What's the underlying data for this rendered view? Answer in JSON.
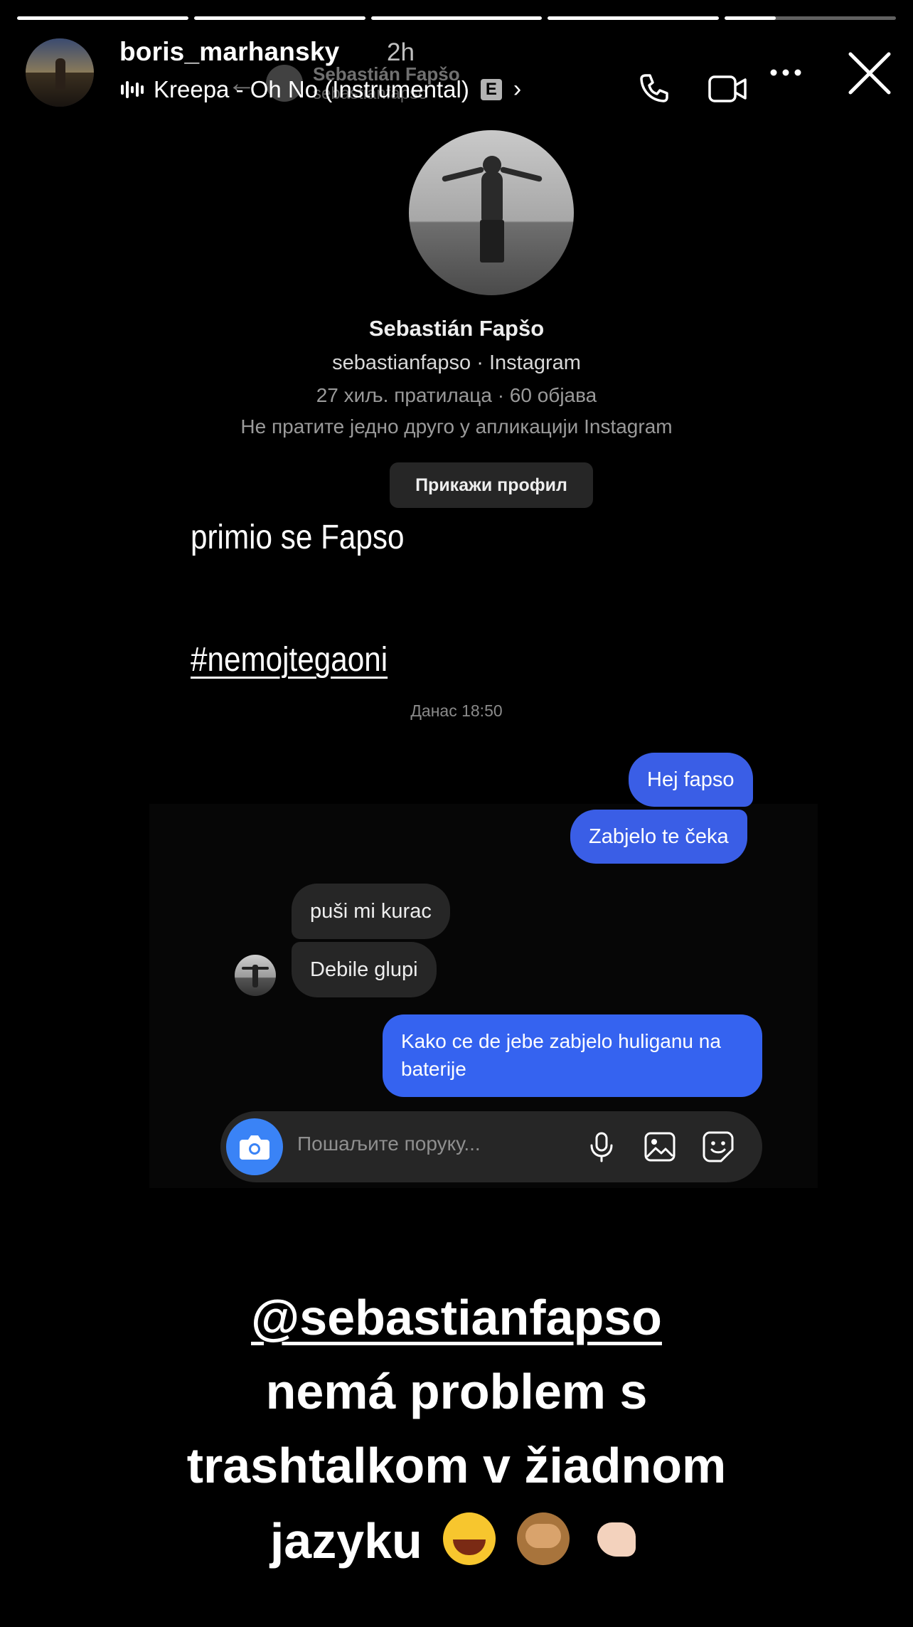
{
  "story": {
    "segments": [
      {
        "progress": 1.0
      },
      {
        "progress": 1.0
      },
      {
        "progress": 1.0
      },
      {
        "progress": 1.0
      },
      {
        "progress": 0.3
      }
    ],
    "username": "boris_marhansky",
    "time_ago": "2h",
    "music": {
      "track": "Kreepa - Oh No (Instrumental)",
      "explicit_badge": "E",
      "chevron": "›"
    },
    "icons": {
      "call": "phone-icon",
      "video": "video-icon",
      "more": "more-icon",
      "close": "close-icon"
    }
  },
  "screenshot": {
    "ghost_header": {
      "name": "Sebastián Fapšo",
      "username": "sebastianfapso"
    },
    "profile": {
      "name": "Sebastián Fapšo",
      "subtitle": "sebastianfapso · Instagram",
      "stats": "27 хиљ. пратилаца · 60 објава",
      "mutual_note": "Не пратите једно друго у апликацији Instagram",
      "view_profile_label": "Прикажи профил"
    },
    "date_label": "Данас 18:50",
    "messages": [
      {
        "from": "me",
        "text": "Hej fapso"
      },
      {
        "from": "me",
        "text": "Zabjelo te čeka"
      },
      {
        "from": "them",
        "text": "puši mi kurac"
      },
      {
        "from": "them",
        "text": "Debile glupi"
      },
      {
        "from": "me",
        "text": "Kako ce de jebe zabjelo huliganu na baterije"
      }
    ],
    "composer": {
      "placeholder": "Пошаљите поруку..."
    }
  },
  "overlay_text": {
    "line1": "primio se Fapso",
    "hashtag": "#nemojtegaoni"
  },
  "caption": {
    "mention": "@sebastianfapso",
    "line2": "nemá problem s",
    "line3": "trashtalkom v žiadnom",
    "line4": "jazyku",
    "emojis": [
      "laugh-icon",
      "monkey-icon",
      "muscle-icon"
    ]
  },
  "colors": {
    "outgoing_bubble": "#3a5ee6",
    "incoming_bubble": "#262626",
    "camera_button": "#3a83f6",
    "background": "#000000"
  }
}
